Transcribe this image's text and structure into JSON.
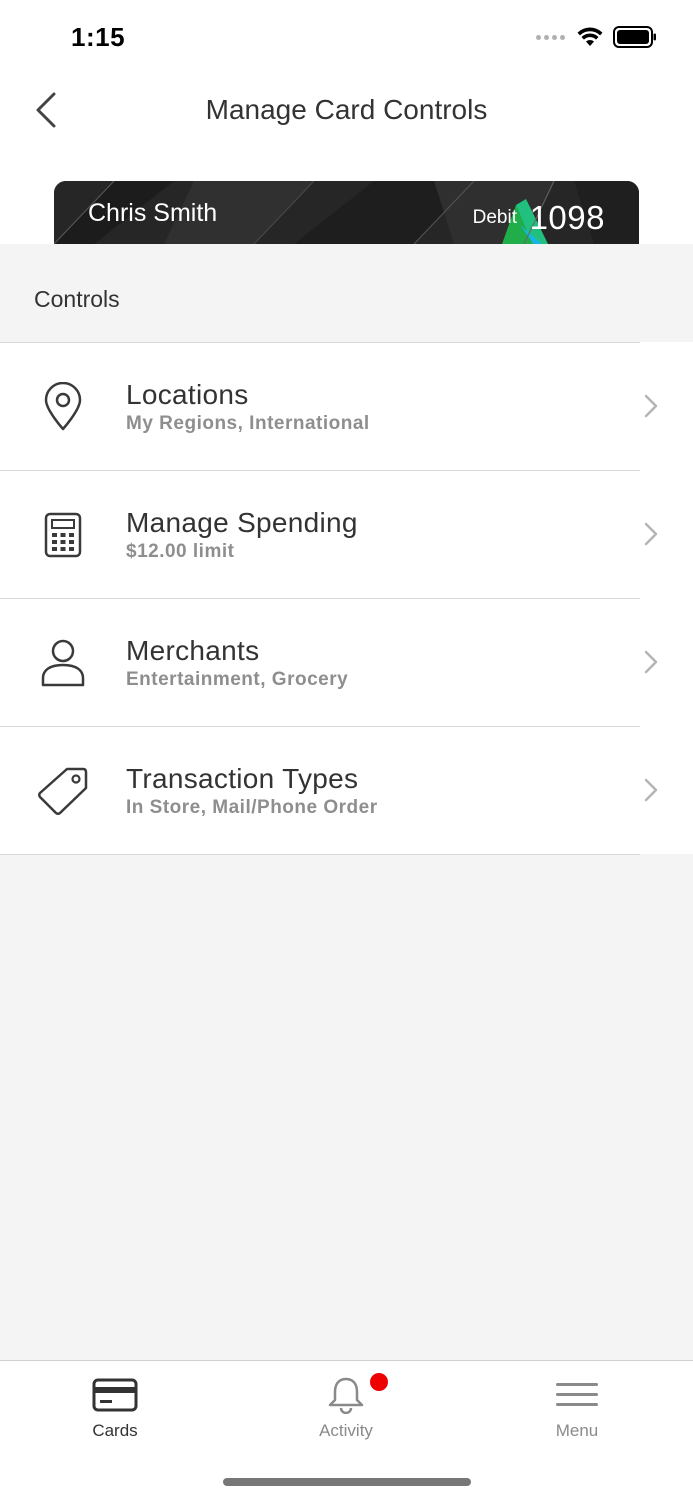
{
  "status_bar": {
    "time": "1:15"
  },
  "nav": {
    "title": "Manage Card Controls"
  },
  "card": {
    "holder_name": "Chris Smith",
    "type": "Debit",
    "last4": "1098"
  },
  "section": {
    "title": "Controls"
  },
  "controls": [
    {
      "title": "Locations",
      "subtitle": "My Regions, International",
      "icon": "location-pin-icon"
    },
    {
      "title": "Manage Spending",
      "subtitle": "$12.00 limit",
      "icon": "calculator-icon"
    },
    {
      "title": "Merchants",
      "subtitle": "Entertainment, Grocery",
      "icon": "person-icon"
    },
    {
      "title": "Transaction Types",
      "subtitle": "In Store, Mail/Phone Order",
      "icon": "tag-icon"
    }
  ],
  "tab_bar": {
    "tabs": [
      {
        "label": "Cards",
        "icon": "card-icon",
        "active": true
      },
      {
        "label": "Activity",
        "icon": "bell-icon",
        "active": false,
        "badge": true
      },
      {
        "label": "Menu",
        "icon": "hamburger-icon",
        "active": false
      }
    ]
  },
  "colors": {
    "badge": "#ee0000",
    "text": "#333333",
    "subtext": "#8e8e8e",
    "background": "#f4f4f4"
  }
}
